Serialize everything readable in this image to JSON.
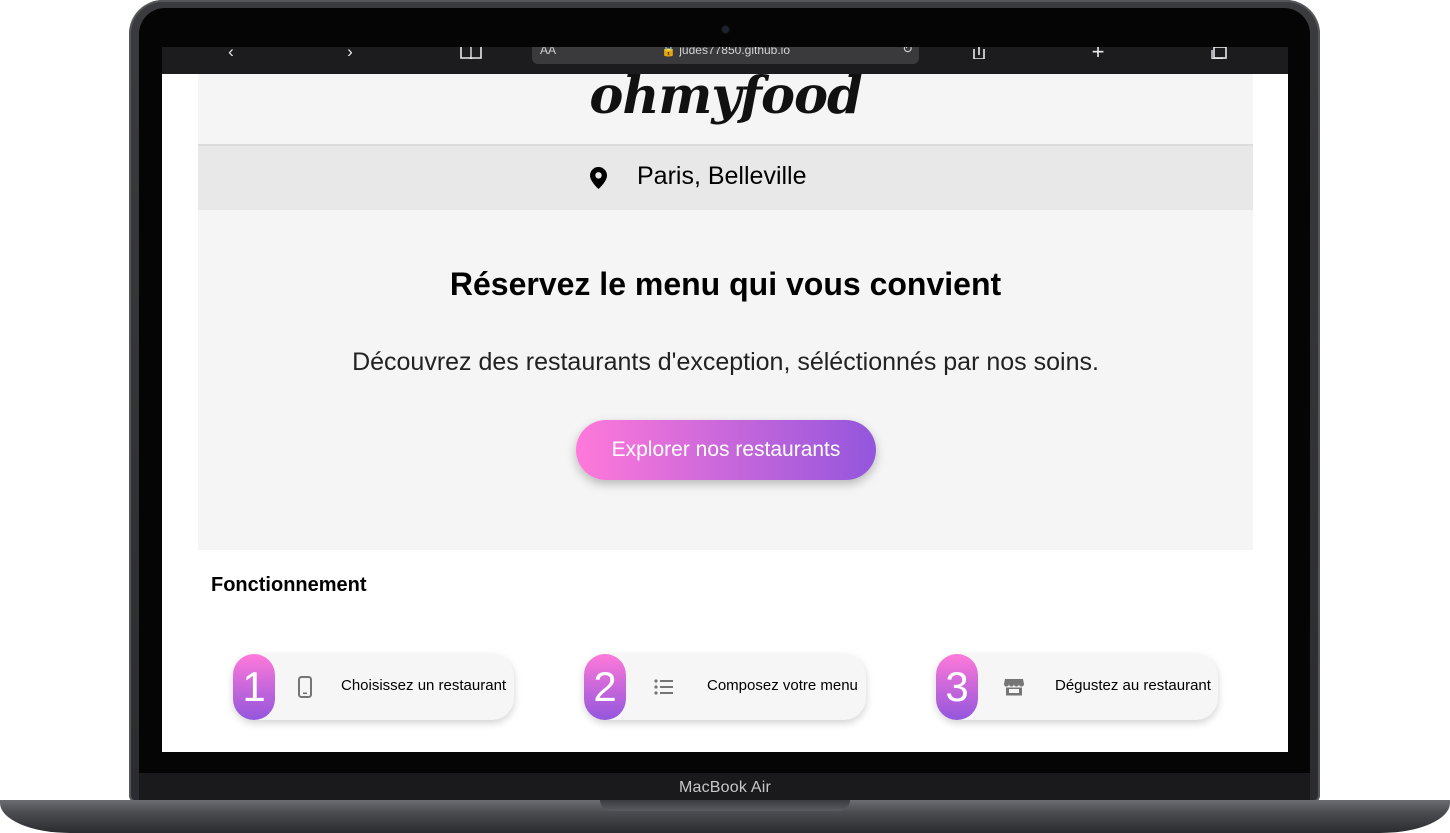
{
  "device": {
    "label": "MacBook Air"
  },
  "browser": {
    "text_size_label": "AA",
    "url": "judes77850.github.io",
    "back_icon": "chevron-left-icon",
    "forward_icon": "chevron-right-icon",
    "bookmarks_icon": "book-icon",
    "reload_icon": "reload-icon",
    "share_icon": "share-icon",
    "new_tab_icon": "plus-icon",
    "tabs_icon": "tabs-icon"
  },
  "header": {
    "logo": "ohmyfood"
  },
  "location": {
    "icon": "location-pin-icon",
    "text": "Paris, Belleville"
  },
  "hero": {
    "title": "Réservez le menu qui vous convient",
    "subtitle": "Découvrez des restaurants d'exception, séléctionnés par nos soins.",
    "cta_label": "Explorer nos restaurants"
  },
  "how_it_works": {
    "title": "Fonctionnement",
    "steps": [
      {
        "number": "1",
        "icon": "phone-icon",
        "label": "Choisissez un restaurant"
      },
      {
        "number": "2",
        "icon": "list-icon",
        "label": "Composez votre menu"
      },
      {
        "number": "3",
        "icon": "store-icon",
        "label": "Dégustez au restaurant"
      }
    ]
  },
  "colors": {
    "gradient_start": "#ff79da",
    "gradient_end": "#9356dc",
    "header_bg": "#f5f5f5",
    "location_bg": "#e8e8e8"
  }
}
